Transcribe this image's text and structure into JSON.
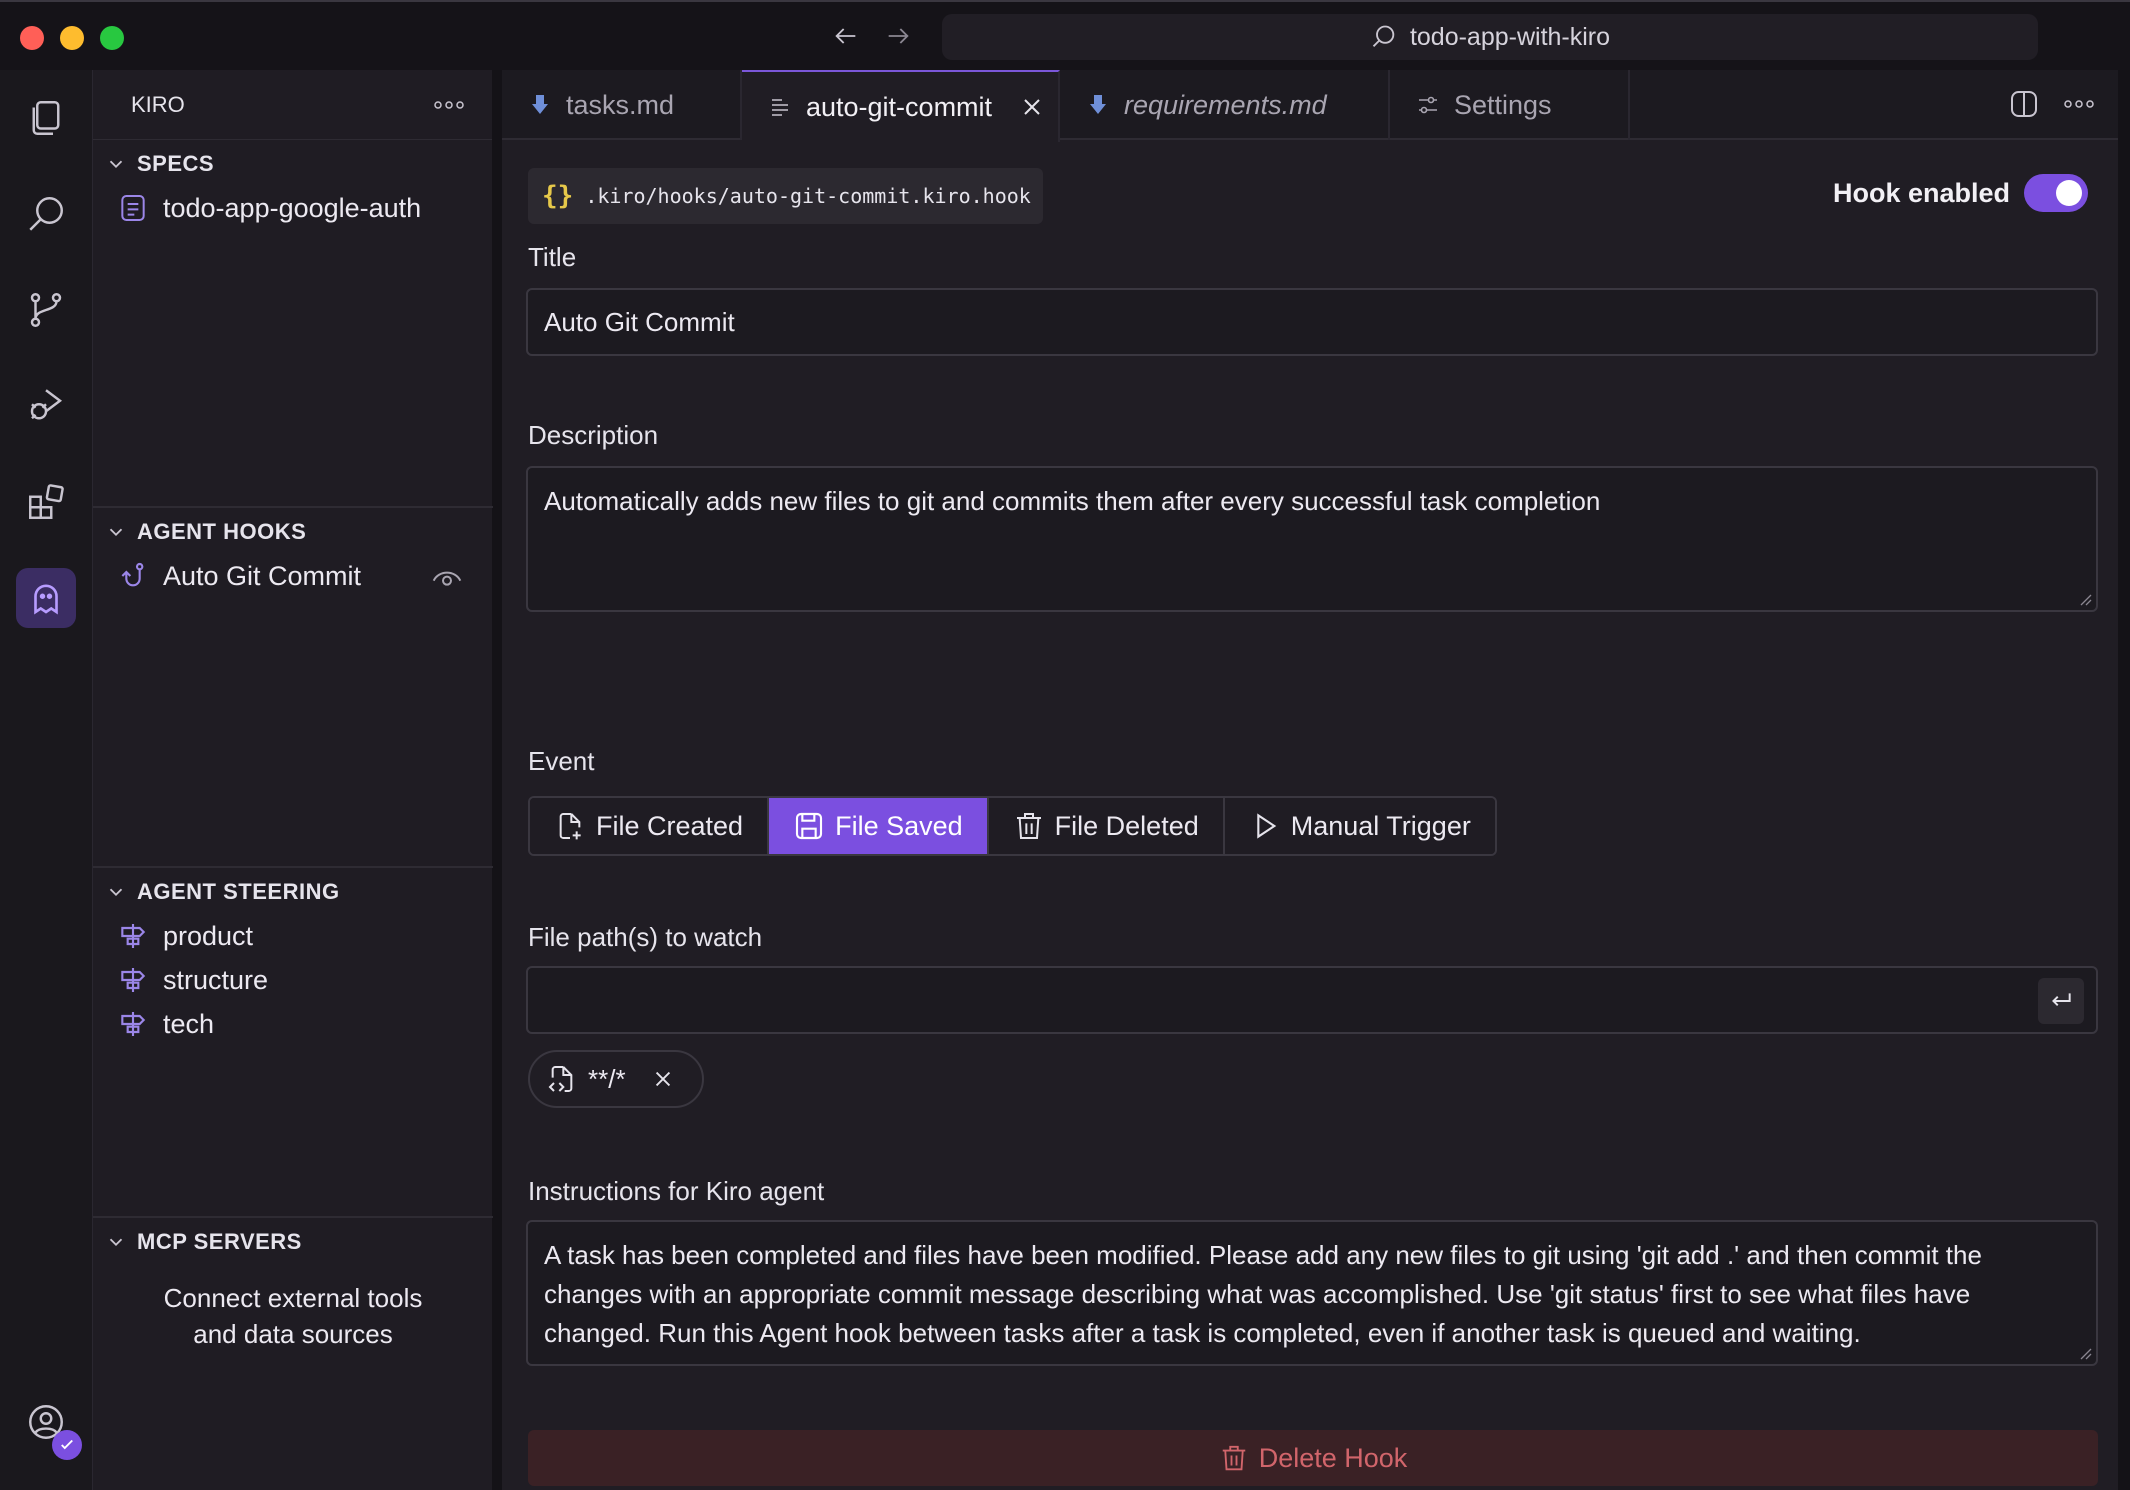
{
  "window": {
    "search_text": "todo-app-with-kiro"
  },
  "colors": {
    "accent": "#7b4fe0",
    "delete_bg": "#3a2125",
    "delete_text": "#d1656b",
    "file_braces": "#e6c84a"
  },
  "activity_bar": {
    "items": [
      {
        "name": "explorer-icon"
      },
      {
        "name": "search-icon"
      },
      {
        "name": "source-control-icon"
      },
      {
        "name": "run-debug-icon"
      },
      {
        "name": "extensions-icon"
      },
      {
        "name": "kiro-ghost-icon",
        "active": true
      }
    ],
    "account": {
      "name": "account-icon"
    }
  },
  "sidebar": {
    "title": "KIRO",
    "sections": {
      "specs": {
        "title": "SPECS",
        "items": [
          "todo-app-google-auth"
        ]
      },
      "agent_hooks": {
        "title": "AGENT HOOKS",
        "items": [
          "Auto Git Commit"
        ]
      },
      "agent_steering": {
        "title": "AGENT STEERING",
        "items": [
          "product",
          "structure",
          "tech"
        ]
      },
      "mcp_servers": {
        "title": "MCP SERVERS",
        "line1": "Connect external tools",
        "line2": "and data sources"
      }
    }
  },
  "tabs": [
    {
      "label": "tasks.md",
      "active": false
    },
    {
      "label": "auto-git-commit",
      "active": true
    },
    {
      "label": "requirements.md",
      "active": false,
      "italic": true
    },
    {
      "label": "Settings",
      "active": false
    }
  ],
  "hook": {
    "file_path": ".kiro/hooks/auto-git-commit.kiro.hook",
    "braces": "{}",
    "enabled_label": "Hook enabled",
    "enabled": true,
    "title_label": "Title",
    "title_value": "Auto Git Commit",
    "description_label": "Description",
    "description_value": "Automatically adds new files to git and commits them after every successful task completion",
    "event_label": "Event",
    "events": [
      {
        "label": "File Created",
        "icon": "file-plus-icon",
        "selected": false
      },
      {
        "label": "File Saved",
        "icon": "save-icon",
        "selected": true
      },
      {
        "label": "File Deleted",
        "icon": "trash-icon",
        "selected": false
      },
      {
        "label": "Manual Trigger",
        "icon": "play-icon",
        "selected": false
      }
    ],
    "paths_label": "File path(s) to watch",
    "paths_input_value": "",
    "patterns": [
      "**/*"
    ],
    "instructions_label": "Instructions for Kiro agent",
    "instructions_line1": "A task has been completed and files have been modified. Please add any new files to git using 'git add .' and then commit the",
    "instructions_line2": "changes with an appropriate commit message describing what was accomplished. Use 'git status' first to see what files have",
    "instructions_line3": "changed. Run this Agent hook between tasks after a task is completed, even if another task is queued and waiting.",
    "delete_label": "Delete Hook"
  }
}
